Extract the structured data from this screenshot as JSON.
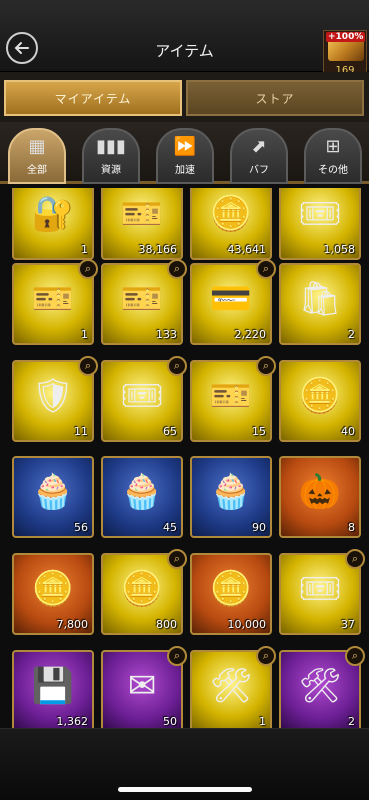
{
  "header": {
    "title": "アイテム",
    "boost_badge": "+100%",
    "boost_count": "169"
  },
  "main_tabs": [
    {
      "label": "マイアイテム"
    },
    {
      "label": "ストア"
    }
  ],
  "categories": [
    {
      "label": "全部",
      "icon": "all-items-icon",
      "glyph": "▦"
    },
    {
      "label": "資源",
      "icon": "resources-icon",
      "glyph": "▮▮▮"
    },
    {
      "label": "加速",
      "icon": "speedup-icon",
      "glyph": "⏩"
    },
    {
      "label": "バフ",
      "icon": "buff-icon",
      "glyph": "⬈"
    },
    {
      "label": "その他",
      "icon": "other-icon",
      "glyph": "⊞"
    }
  ],
  "items": [
    {
      "name": "item-safe",
      "glyph": "🔐",
      "qty": "1",
      "color": "yellow",
      "magnifier": false
    },
    {
      "name": "item-ticket-silver",
      "glyph": "🎫",
      "qty": "38,166",
      "color": "yellow",
      "magnifier": false
    },
    {
      "name": "item-coins-gold",
      "glyph": "🪙",
      "qty": "43,641",
      "color": "yellow",
      "magnifier": false
    },
    {
      "name": "item-ticket-red",
      "glyph": "🎟",
      "qty": "1,058",
      "color": "yellow",
      "magnifier": false
    },
    {
      "name": "item-blue-ticket",
      "glyph": "🎫",
      "qty": "1",
      "color": "yellow",
      "magnifier": true
    },
    {
      "name": "item-black-ticket",
      "glyph": "🎫",
      "qty": "133",
      "color": "yellow",
      "magnifier": true
    },
    {
      "name": "item-silver-card",
      "glyph": "💳",
      "qty": "2,220",
      "color": "yellow",
      "magnifier": true
    },
    {
      "name": "item-gift-bag",
      "glyph": "🛍",
      "qty": "2",
      "color": "yellow",
      "magnifier": false
    },
    {
      "name": "item-skull-chest",
      "glyph": "🛡",
      "qty": "11",
      "color": "yellow",
      "magnifier": true
    },
    {
      "name": "item-arrow-ticket",
      "glyph": "🎟",
      "qty": "65",
      "color": "yellow",
      "magnifier": true
    },
    {
      "name": "item-gold-ticket",
      "glyph": "🎫",
      "qty": "15",
      "color": "yellow",
      "magnifier": true
    },
    {
      "name": "item-gold-coin",
      "glyph": "🪙",
      "qty": "40",
      "color": "yellow",
      "magnifier": false
    },
    {
      "name": "item-cupcakes-1",
      "glyph": "🧁",
      "qty": "56",
      "color": "blue",
      "magnifier": false
    },
    {
      "name": "item-cupcakes-2",
      "glyph": "🧁",
      "qty": "45",
      "color": "blue",
      "magnifier": false
    },
    {
      "name": "item-cupcakes-3",
      "glyph": "🧁",
      "qty": "90",
      "color": "blue",
      "magnifier": false
    },
    {
      "name": "item-pumpkin",
      "glyph": "🎃",
      "qty": "8",
      "color": "orange",
      "magnifier": false
    },
    {
      "name": "item-silver-coin-1",
      "glyph": "🪙",
      "qty": "7,800",
      "color": "orange",
      "magnifier": false
    },
    {
      "name": "item-gold-coin-2",
      "glyph": "🪙",
      "qty": "800",
      "color": "yellow",
      "magnifier": true
    },
    {
      "name": "item-silver-coin-2",
      "glyph": "🪙",
      "qty": "10,000",
      "color": "orange",
      "magnifier": false
    },
    {
      "name": "item-ticket-box",
      "glyph": "🎟",
      "qty": "37",
      "color": "yellow",
      "magnifier": true
    },
    {
      "name": "item-usb",
      "glyph": "💾",
      "qty": "1,362",
      "color": "purple",
      "magnifier": false
    },
    {
      "name": "item-envelopes",
      "glyph": "✉",
      "qty": "50",
      "color": "purple",
      "magnifier": true
    },
    {
      "name": "item-tools-1",
      "glyph": "🛠",
      "qty": "1",
      "color": "yellow",
      "magnifier": true
    },
    {
      "name": "item-tools-2",
      "glyph": "🛠",
      "qty": "2",
      "color": "purple",
      "magnifier": true
    }
  ]
}
